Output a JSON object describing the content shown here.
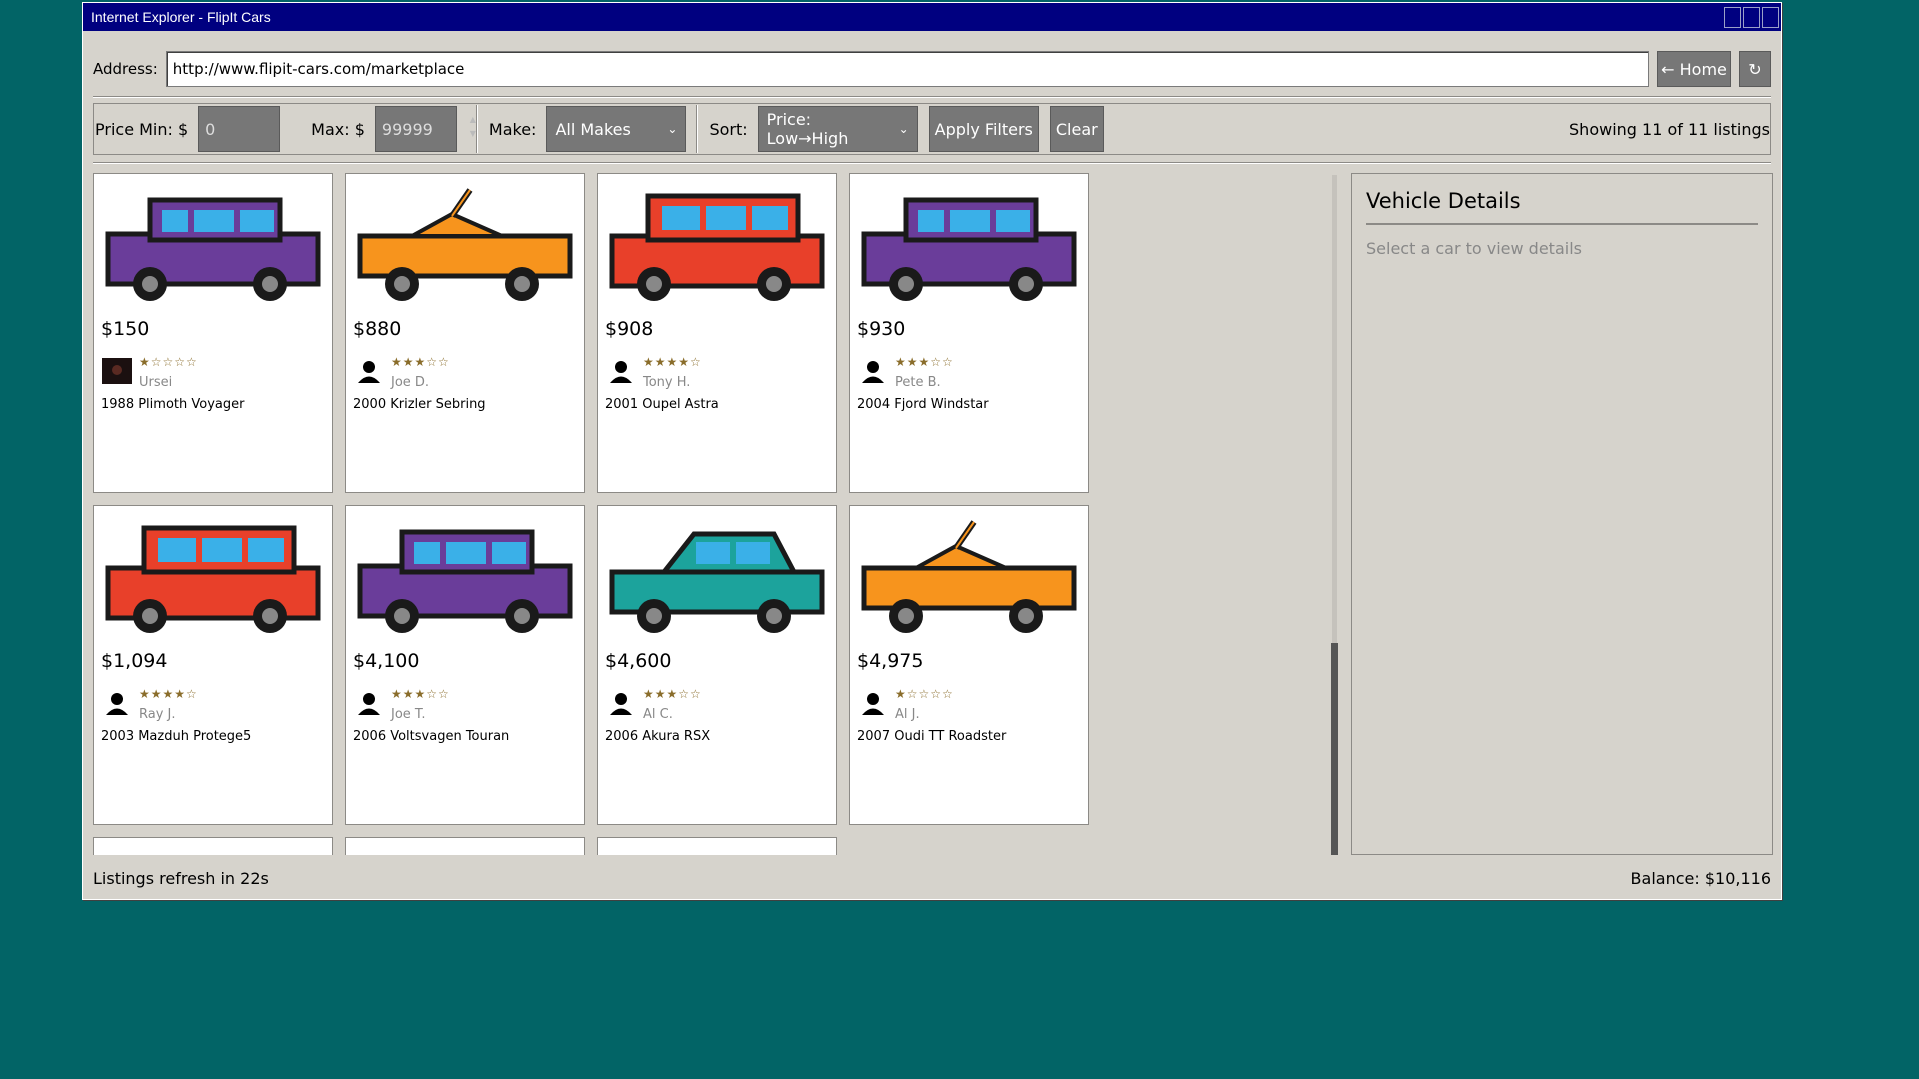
{
  "window": {
    "title": "Internet Explorer - FlipIt Cars"
  },
  "address": {
    "label": "Address:",
    "url": "http://www.flipit-cars.com/marketplace",
    "home_label": "← Home",
    "refresh_label": "↻"
  },
  "filters": {
    "price_min_label": "Price Min: $",
    "price_min_value": "0",
    "price_max_label": "Max: $",
    "price_max_value": "99999",
    "make_label": "Make:",
    "make_value": "All Makes",
    "sort_label": "Sort:",
    "sort_value": "Price: Low→High",
    "apply_label": "Apply Filters",
    "clear_label": "Clear",
    "showing_text": "Showing 11 of 11 listings"
  },
  "listings": [
    {
      "price": "$150",
      "stars": "★☆☆☆☆",
      "rating": 1,
      "seller": "Ursei",
      "model": "1988 Plimoth Voyager",
      "car_color": "#6a3d9a",
      "car_shape": "van",
      "avatar": "photo"
    },
    {
      "price": "$880",
      "stars": "★★★☆☆",
      "rating": 3,
      "seller": "Joe D.",
      "model": "2000 Krizler Sebring",
      "car_color": "#f7941d",
      "car_shape": "convertible",
      "avatar": "person"
    },
    {
      "price": "$908",
      "stars": "★★★★☆",
      "rating": 4,
      "seller": "Tony H.",
      "model": "2001 Oupel Astra",
      "car_color": "#e8402a",
      "car_shape": "hatch",
      "avatar": "person"
    },
    {
      "price": "$930",
      "stars": "★★★☆☆",
      "rating": 3,
      "seller": "Pete B.",
      "model": "2004 Fjord Windstar",
      "car_color": "#6a3d9a",
      "car_shape": "van",
      "avatar": "person"
    },
    {
      "price": "$1,094",
      "stars": "★★★★☆",
      "rating": 4,
      "seller": "Ray J.",
      "model": "2003 Mazduh Protege5",
      "car_color": "#e8402a",
      "car_shape": "hatch",
      "avatar": "person"
    },
    {
      "price": "$4,100",
      "stars": "★★★☆☆",
      "rating": 3,
      "seller": "Joe T.",
      "model": "2006 Voltsvagen Touran",
      "car_color": "#6a3d9a",
      "car_shape": "van",
      "avatar": "person"
    },
    {
      "price": "$4,600",
      "stars": "★★★☆☆",
      "rating": 3,
      "seller": "Al C.",
      "model": "2006 Akura RSX",
      "car_color": "#1ca39c",
      "car_shape": "coupe",
      "avatar": "person"
    },
    {
      "price": "$4,975",
      "stars": "★☆☆☆☆",
      "rating": 1,
      "seller": "Al J.",
      "model": "2007 Oudi TT Roadster",
      "car_color": "#f7941d",
      "car_shape": "convertible",
      "avatar": "person"
    }
  ],
  "details": {
    "title": "Vehicle Details",
    "hint": "Select a car to view details"
  },
  "status": {
    "refresh_text": "Listings refresh in 22s",
    "balance_text": "Balance: $10,116"
  }
}
